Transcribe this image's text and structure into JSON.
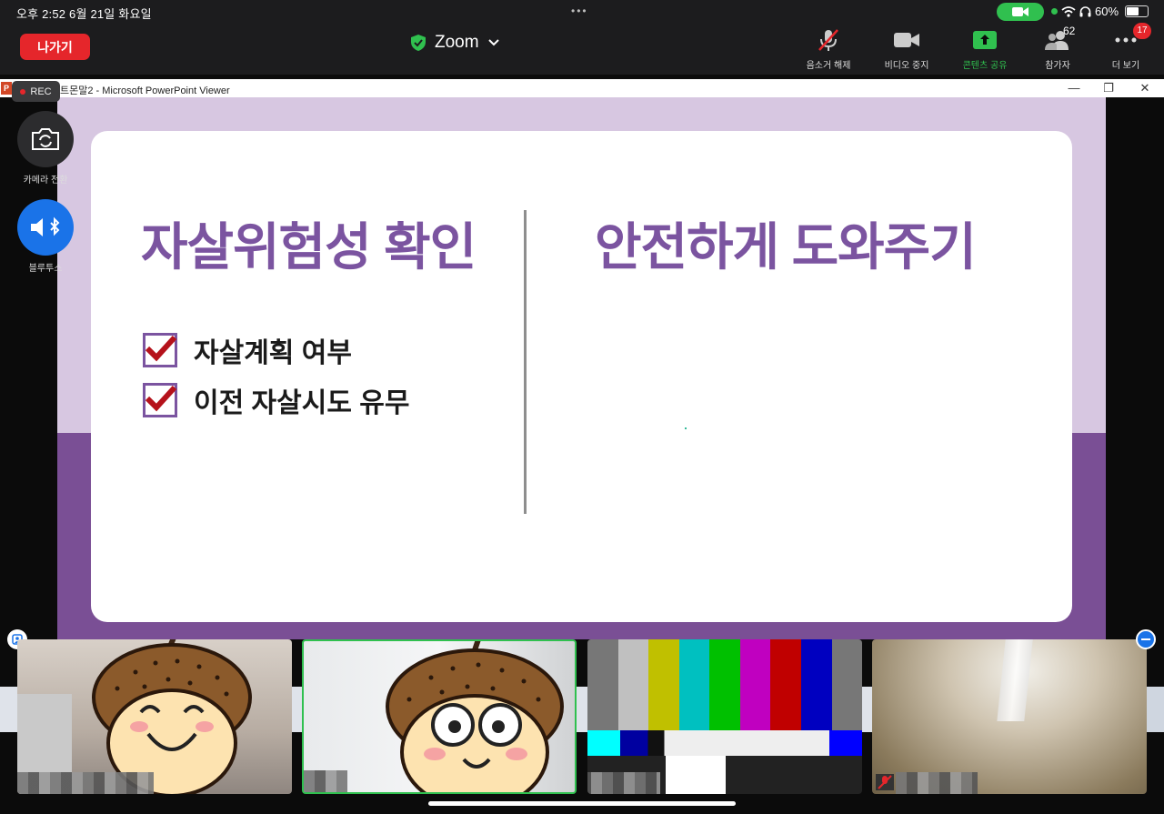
{
  "status_bar": {
    "time_date": "오후 2:52   6월 21일 화요일",
    "dots": "•••",
    "battery": "60%",
    "battery_level": 0.6
  },
  "top_bar": {
    "leave_label": "나가기",
    "meeting_title": "Zoom",
    "tools": {
      "unmute": "음소거 해제",
      "stop_video": "비디오 중지",
      "share": "콘텐츠 공유",
      "participants": "참가자",
      "participants_count": "62",
      "more": "더 보기",
      "more_badge": "17"
    }
  },
  "ppt_window": {
    "title_suffix": "트몬말2 - Microsoft PowerPoint Viewer",
    "logo_letter": "P",
    "minimize": "—",
    "restore": "❐",
    "close": "✕"
  },
  "slide": {
    "left_heading": "자살위험성 확인",
    "right_heading": "안전하게 도와주기",
    "checklist": [
      "자살계획 여부",
      "이전 자살시도 유무"
    ]
  },
  "floating": {
    "rec_label": "REC",
    "camera_switch_label": "카메라 전환",
    "bluetooth_label": "블루투스"
  },
  "colors": {
    "zoom_green": "#30c04f",
    "leave_red": "#e5262b",
    "slide_purple": "#7b54a0",
    "slide_lavender": "#d7c7e1"
  }
}
